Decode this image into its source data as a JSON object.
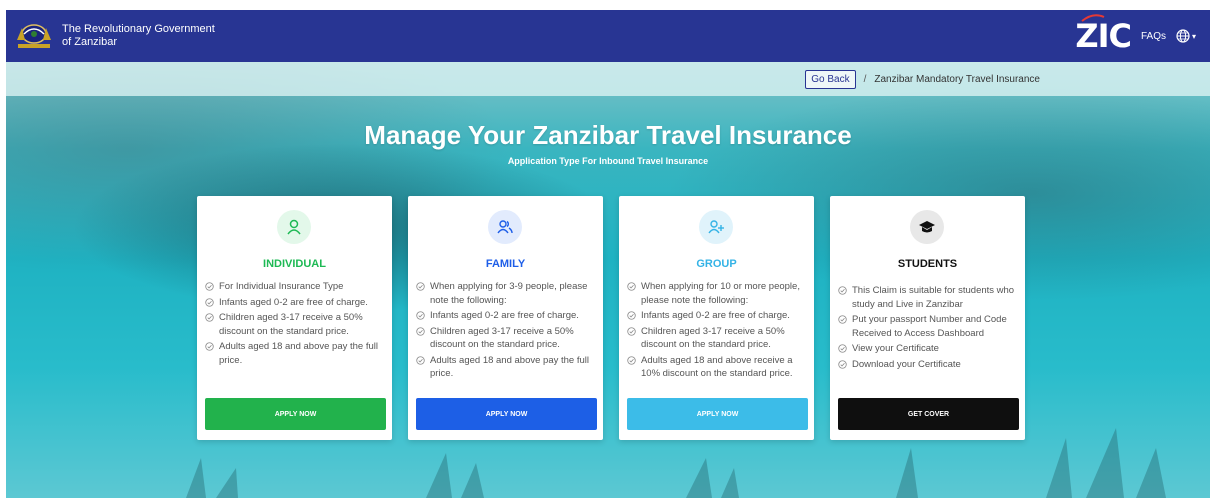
{
  "header": {
    "gov_line1": "The Revolutionary Government",
    "gov_line2": "of Zanzibar",
    "logo_text": "ZIC",
    "faqs_label": "FAQs",
    "emblem_icon": "coat-of-arms-icon",
    "language_icon": "globe-icon",
    "bar_color": "#283593"
  },
  "breadcrumb": {
    "back_label": "Go Back",
    "separator": "/",
    "current": "Zanzibar Mandatory Travel Insurance"
  },
  "hero": {
    "title": "Manage Your Zanzibar Travel Insurance",
    "subtitle": "Application Type For Inbound Travel Insurance"
  },
  "cards": [
    {
      "title": "INDIVIDUAL",
      "icon": "user-icon",
      "accent": "#1db954",
      "icon_bg": "#e3f8ea",
      "items": [
        "For Individual Insurance Type",
        "Infants aged 0-2 are free of charge.",
        "Children aged 3-17 receive a 50% discount on the standard price.",
        "Adults aged 18 and above pay the full price."
      ],
      "button": "APPLY NOW",
      "button_color": "#22b24c"
    },
    {
      "title": "FAMILY",
      "icon": "users-icon",
      "accent": "#1e5ee8",
      "icon_bg": "#e2ebfd",
      "items": [
        "When applying for 3-9 people, please note the following:",
        "Infants aged 0-2 are free of charge.",
        "Children aged 3-17 receive a 50% discount on the standard price.",
        "Adults aged 18 and above pay the full price."
      ],
      "button": "APPLY NOW",
      "button_color": "#1d5fe6"
    },
    {
      "title": "GROUP",
      "icon": "user-plus-icon",
      "accent": "#34b3e6",
      "icon_bg": "#e0f3fb",
      "items": [
        "When applying for 10 or more people, please note the following:",
        "Infants aged 0-2 are free of charge.",
        "Children aged 3-17 receive a 50% discount on the standard price.",
        "Adults aged 18 and above receive a 10% discount on the standard price."
      ],
      "button": "APPLY NOW",
      "button_color": "#3cbce8"
    },
    {
      "title": "STUDENTS",
      "icon": "graduation-cap-icon",
      "accent": "#111111",
      "icon_bg": "#e8e8e8",
      "items": [
        "This Claim is suitable for students who study and Live in Zanzibar",
        "Put your passport Number and Code Received to Access Dashboard",
        "View your Certificate",
        "Download your Certificate"
      ],
      "button": "GET COVER",
      "button_color": "#0f0f0f"
    }
  ]
}
